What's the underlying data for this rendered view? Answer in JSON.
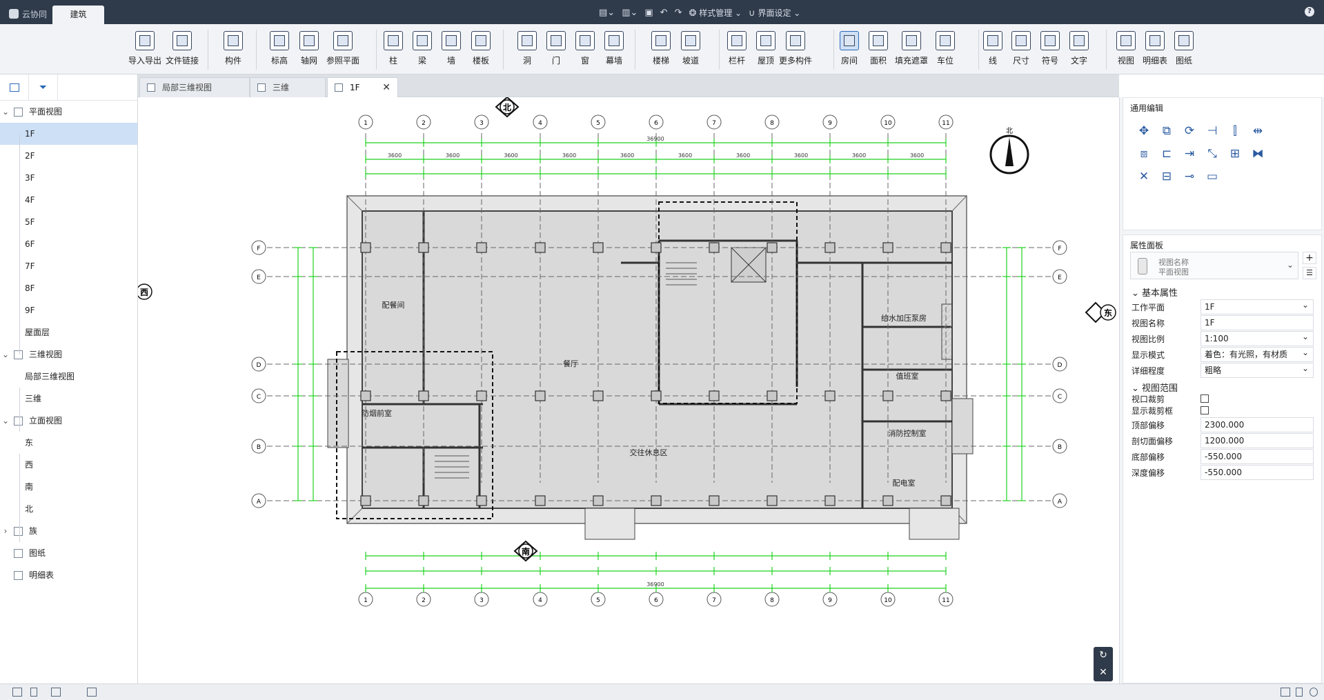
{
  "app": {
    "cloud_tab": "云协同",
    "active_tab": "建筑",
    "qat": {
      "style_manage": "样式管理",
      "ui_settings": "界面设定"
    },
    "help": "?"
  },
  "ribbon": {
    "items": [
      {
        "label": "导入导出",
        "icon": "cad-import-icon"
      },
      {
        "label": "文件链接",
        "icon": "file-link-icon"
      },
      {
        "label": "构件",
        "icon": "component-icon"
      },
      {
        "label": "标高",
        "icon": "level-icon"
      },
      {
        "label": "轴网",
        "icon": "grid-icon"
      },
      {
        "label": "参照平面",
        "icon": "ref-plane-icon"
      },
      {
        "label": "柱",
        "icon": "column-icon"
      },
      {
        "label": "梁",
        "icon": "beam-icon"
      },
      {
        "label": "墙",
        "icon": "wall-icon"
      },
      {
        "label": "楼板",
        "icon": "slab-icon"
      },
      {
        "label": "洞",
        "icon": "opening-icon"
      },
      {
        "label": "门",
        "icon": "door-icon"
      },
      {
        "label": "窗",
        "icon": "window-icon"
      },
      {
        "label": "幕墙",
        "icon": "curtain-wall-icon"
      },
      {
        "label": "楼梯",
        "icon": "stair-icon"
      },
      {
        "label": "坡道",
        "icon": "ramp-icon"
      },
      {
        "label": "栏杆",
        "icon": "railing-icon"
      },
      {
        "label": "屋顶",
        "icon": "roof-icon"
      },
      {
        "label": "更多构件",
        "icon": "more-components-icon"
      },
      {
        "label": "房间",
        "icon": "room-icon"
      },
      {
        "label": "面积",
        "icon": "area-icon"
      },
      {
        "label": "填充遮罩",
        "icon": "fill-mask-icon"
      },
      {
        "label": "车位",
        "icon": "parking-icon"
      },
      {
        "label": "线",
        "icon": "line-icon"
      },
      {
        "label": "尺寸",
        "icon": "dimension-icon"
      },
      {
        "label": "符号",
        "icon": "symbol-icon"
      },
      {
        "label": "文字",
        "icon": "text-icon"
      },
      {
        "label": "视图",
        "icon": "view-icon"
      },
      {
        "label": "明细表",
        "icon": "schedule-icon"
      },
      {
        "label": "图纸",
        "icon": "sheet-icon"
      }
    ]
  },
  "tree": {
    "nodes": [
      {
        "label": "平面视图",
        "level": 0,
        "expanded": true
      },
      {
        "label": "1F",
        "level": 1,
        "selected": true
      },
      {
        "label": "2F",
        "level": 1
      },
      {
        "label": "3F",
        "level": 1
      },
      {
        "label": "4F",
        "level": 1
      },
      {
        "label": "5F",
        "level": 1
      },
      {
        "label": "6F",
        "level": 1
      },
      {
        "label": "7F",
        "level": 1
      },
      {
        "label": "8F",
        "level": 1
      },
      {
        "label": "9F",
        "level": 1
      },
      {
        "label": "屋面层",
        "level": 1
      },
      {
        "label": "三维视图",
        "level": 0,
        "expanded": true
      },
      {
        "label": "局部三维视图",
        "level": 1
      },
      {
        "label": "三维",
        "level": 1
      },
      {
        "label": "立面视图",
        "level": 0,
        "expanded": true
      },
      {
        "label": "东",
        "level": 1
      },
      {
        "label": "西",
        "level": 1
      },
      {
        "label": "南",
        "level": 1
      },
      {
        "label": "北",
        "level": 1
      },
      {
        "label": "族",
        "level": 0,
        "expanded": false
      },
      {
        "label": "图纸",
        "level": 0
      },
      {
        "label": "明细表",
        "level": 0
      }
    ]
  },
  "doc_tabs": [
    {
      "label": "局部三维视图"
    },
    {
      "label": "三维"
    },
    {
      "label": "1F",
      "active": true
    }
  ],
  "drawing": {
    "compass": {
      "north": "北",
      "south": "南",
      "east": "东",
      "west": "西",
      "north_arrow": "北"
    },
    "axes_x": [
      "1",
      "2",
      "3",
      "4",
      "5",
      "6",
      "7",
      "8",
      "9",
      "10",
      "11"
    ],
    "axes_y": [
      "F",
      "E",
      "D",
      "C",
      "B",
      "A"
    ],
    "total_dim": "36900",
    "top_dims": [
      "3600",
      "3600",
      "3600",
      "3600",
      "3600",
      "3600",
      "3600",
      "3600",
      "3600",
      "3600"
    ],
    "rooms": [
      "配餐间",
      "餐厅",
      "防烟前室",
      "给水加压泵房",
      "值班室",
      "消防控制室",
      "配电室",
      "交往休息区"
    ]
  },
  "right": {
    "common_edit": "通用编辑",
    "props_title": "属性面板",
    "type_card": {
      "line1": "视图名称",
      "line2": "平面视图"
    },
    "basic_props": "基本属性",
    "fields": [
      {
        "label": "工作平面",
        "value": "1F",
        "dropdown": true
      },
      {
        "label": "视图名称",
        "value": "1F"
      },
      {
        "label": "视图比例",
        "value": "1:100",
        "dropdown": true
      },
      {
        "label": "显示模式",
        "value": "着色：有光照，有材质",
        "dropdown": true
      },
      {
        "label": "详细程度",
        "value": "粗略",
        "dropdown": true
      }
    ],
    "view_range": "视图范围",
    "checks": [
      {
        "label": "视口裁剪",
        "checked": false
      },
      {
        "label": "显示裁剪框",
        "checked": false
      }
    ],
    "offsets": [
      {
        "label": "顶部偏移",
        "value": "2300.000"
      },
      {
        "label": "剖切面偏移",
        "value": "1200.000"
      },
      {
        "label": "底部偏移",
        "value": "-550.000"
      },
      {
        "label": "深度偏移",
        "value": "-550.000"
      }
    ]
  }
}
